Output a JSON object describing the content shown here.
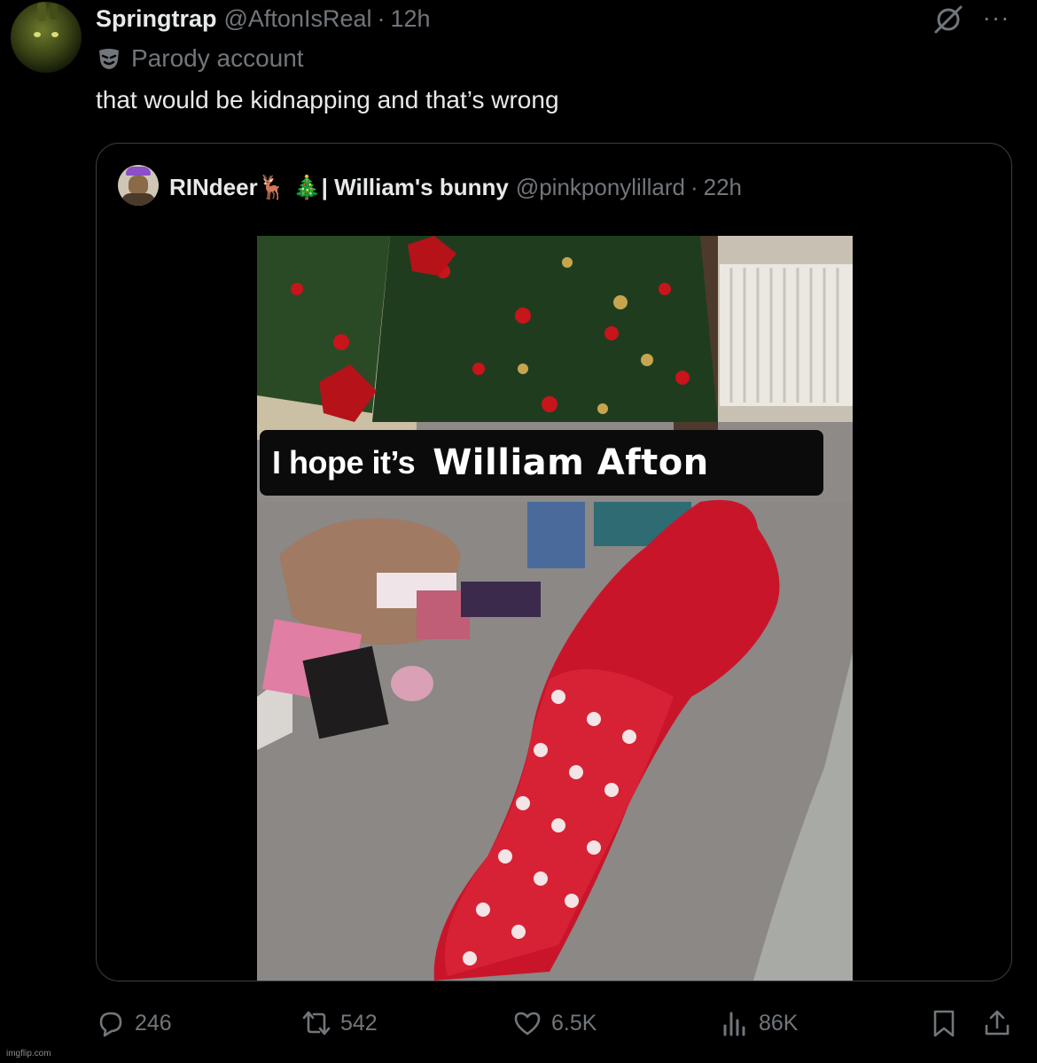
{
  "post": {
    "author_name": "Springtrap",
    "handle": "@AftonIsReal",
    "separator": "·",
    "time": "12h",
    "badge_label": "Parody account",
    "more_label": "···",
    "text": "that would be kidnapping and that’s wrong"
  },
  "quote": {
    "author_name": "RINdeer🦌 🎄| William's bunny",
    "handle": "@pinkponylillard",
    "separator": "·",
    "time": "22h",
    "media": {
      "caption_part1": "I hope it’s",
      "caption_part2": "William Afton"
    }
  },
  "actions": {
    "replies": "246",
    "reposts": "542",
    "likes": "6.5K",
    "views": "86K"
  },
  "icons": {
    "reply": "reply-icon",
    "repost": "repost-icon",
    "like": "heart-icon",
    "views": "views-icon",
    "bookmark": "bookmark-icon",
    "share": "share-icon",
    "grok": "grok-icon",
    "more": "more-icon",
    "parody": "mask-icon"
  },
  "colors": {
    "background": "#000000",
    "text": "#e7e9ea",
    "muted": "#71767b",
    "border": "#3b3f43"
  },
  "watermark": "imgflip.com"
}
